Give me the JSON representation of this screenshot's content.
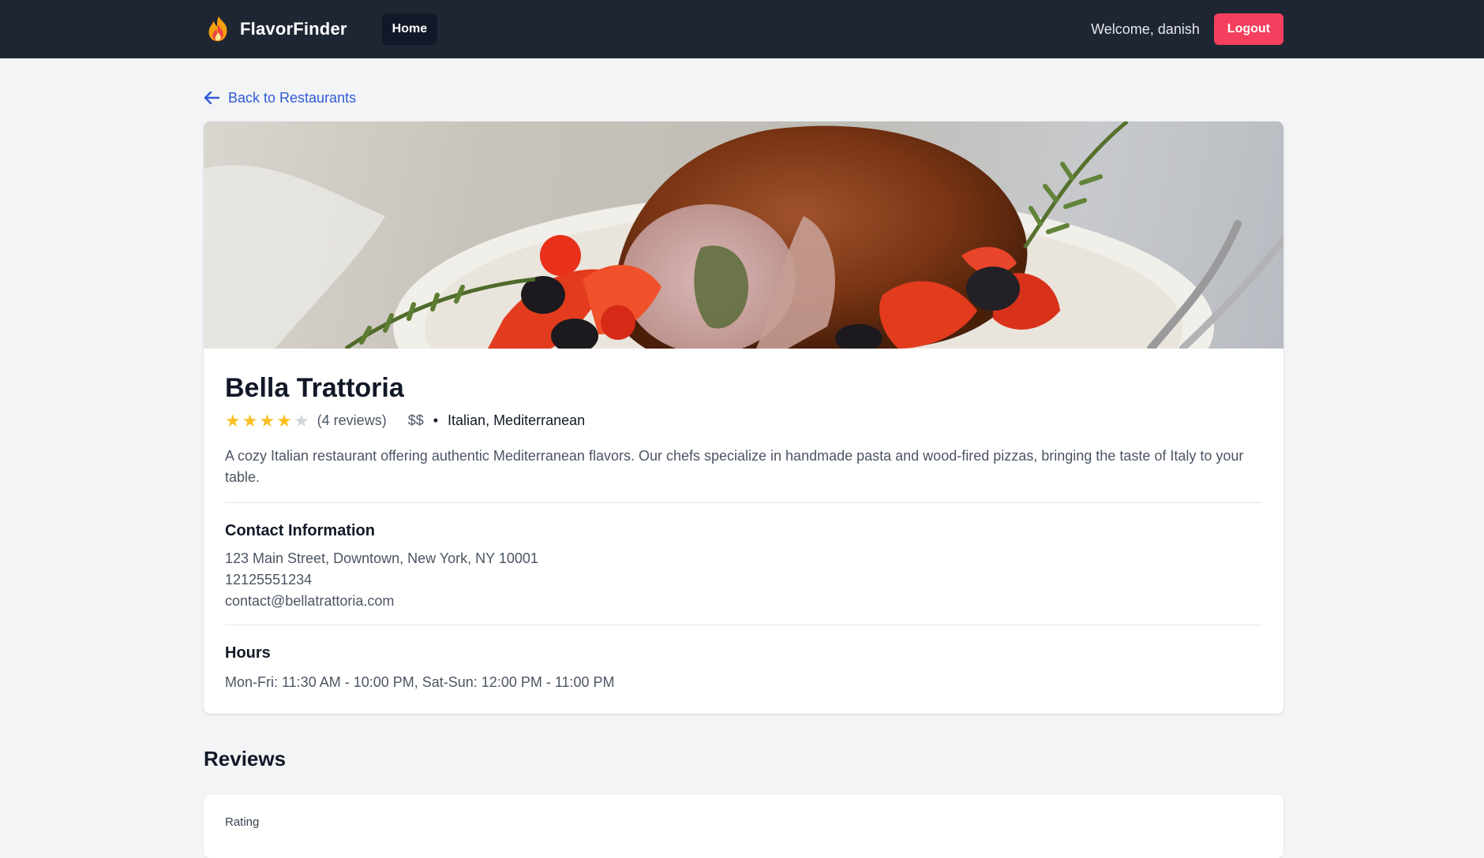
{
  "navbar": {
    "brand": "FlavorFinder",
    "brand_icon": "flame-icon",
    "home_label": "Home",
    "welcome_text": "Welcome, danish",
    "logout_label": "Logout"
  },
  "back_link": {
    "label": "Back to Restaurants",
    "icon": "arrow-left-icon"
  },
  "restaurant": {
    "name": "Bella Trattoria",
    "rating": 4,
    "rating_max": 5,
    "reviews_text": "(4 reviews)",
    "price": "$$",
    "cuisine": "Italian, Mediterranean",
    "description": "A cozy Italian restaurant offering authentic Mediterranean flavors. Our chefs specialize in handmade pasta and wood-fired pizzas, bringing the taste of Italy to your table.",
    "contact_title": "Contact Information",
    "address": "123 Main Street, Downtown, New York, NY 10001",
    "phone": "12125551234",
    "email": "contact@bellatrattoria.com",
    "hours_title": "Hours",
    "hours": "Mon-Fri: 11:30 AM - 10:00 PM, Sat-Sun: 12:00 PM - 11:00 PM"
  },
  "reviews_section": {
    "title": "Reviews",
    "form_rating_label": "Rating"
  },
  "colors": {
    "navbar_bg": "#1f2633",
    "logout_bg": "#f43f5e",
    "link": "#2f5bd6",
    "star_on": "#fbbf24",
    "star_off": "#d1d5db"
  }
}
